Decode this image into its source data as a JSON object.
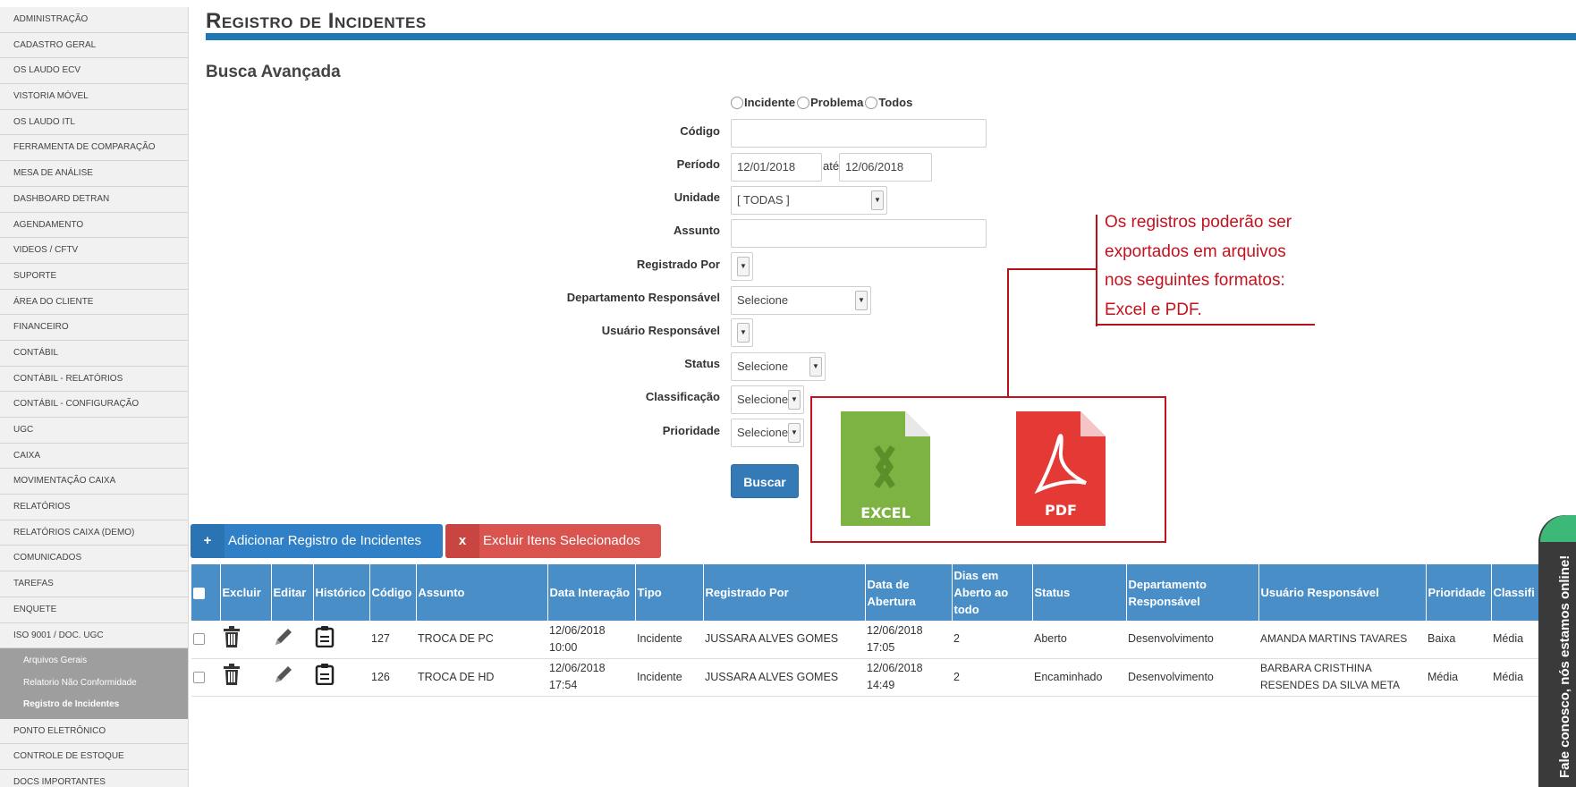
{
  "sidebar": {
    "items": [
      "ADMINISTRAÇÃO",
      "CADASTRO GERAL",
      "OS LAUDO ECV",
      "VISTORIA MÓVEL",
      "OS LAUDO ITL",
      "FERRAMENTA DE COMPARAÇÃO",
      "MESA DE ANÁLISE",
      "DASHBOARD DETRAN",
      "AGENDAMENTO",
      "VIDEOS / CFTV",
      "SUPORTE",
      "ÁREA DO CLIENTE",
      "FINANCEIRO",
      "CONTÁBIL",
      "CONTÁBIL - RELATÓRIOS",
      "CONTÁBIL - CONFIGURAÇÃO",
      "UGC",
      "CAIXA",
      "MOVIMENTAÇÃO CAIXA",
      "RELATÓRIOS",
      "RELATÓRIOS CAIXA (DEMO)",
      "COMUNICADOS",
      "TAREFAS",
      "ENQUETE",
      "ISO 9001 / DOC. UGC"
    ],
    "subitems": [
      "Arquivos Gerais",
      "Relatorio Não Conformidade",
      "Registro de Incidentes"
    ],
    "items_after": [
      "PONTO ELETRÔNICO",
      "CONTROLE DE ESTOQUE",
      "DOCS IMPORTANTES"
    ]
  },
  "header": {
    "title": "Registro de Incidentes"
  },
  "search": {
    "title": "Busca Avançada",
    "radios": [
      "Incidente",
      "Problema",
      "Todos"
    ],
    "labels": {
      "codigo": "Código",
      "periodo": "Período",
      "unidade": "Unidade",
      "assunto": "Assunto",
      "registrado_por": "Registrado Por",
      "departamento": "Departamento Responsável",
      "usuario": "Usuário Responsável",
      "status": "Status",
      "classificacao": "Classificação",
      "prioridade": "Prioridade"
    },
    "values": {
      "codigo": "",
      "periodo_inicio": "12/01/2018",
      "ate": "até",
      "periodo_fim": "12/06/2018",
      "unidade": "[ TODAS ]",
      "assunto": "",
      "registrado_por": "",
      "departamento": "Selecione",
      "usuario": "",
      "status": "Selecione",
      "classificacao": "Selecione",
      "prioridade": "Selecione"
    },
    "buscar_label": "Buscar"
  },
  "annotation": {
    "lines": [
      "Os registros poderão ser",
      "exportados em arquivos",
      "nos seguintes formatos:",
      "Excel e PDF."
    ],
    "excel_label": "EXCEL",
    "pdf_label": "PDF",
    "colors": {
      "annotation": "#c4121e",
      "excel": "#7cb342",
      "pdf": "#d32f2f"
    }
  },
  "actions": {
    "add_prefix": "+",
    "add_label": "Adicionar Registro de Incidentes",
    "delete_prefix": "x",
    "delete_label": "Excluir Itens Selecionados"
  },
  "table": {
    "headers": {
      "excluir": "Excluir",
      "editar": "Editar",
      "historico": "Histórico",
      "codigo": "Código",
      "assunto": "Assunto",
      "data_interacao": "Data Interação",
      "tipo": "Tipo",
      "registrado_por": "Registrado Por",
      "data_abertura": "Data de Abertura",
      "dias_aberto": "Dias em Aberto ao todo",
      "status": "Status",
      "departamento": "Departamento Responsável",
      "usuario": "Usuário Responsável",
      "prioridade": "Prioridade",
      "classificacao": "Classifi"
    },
    "rows": [
      {
        "codigo": "127",
        "assunto": "TROCA DE PC",
        "data_interacao_date": "12/06/2018",
        "data_interacao_time": "10:00",
        "tipo": "Incidente",
        "registrado_por": "JUSSARA ALVES GOMES",
        "data_abertura_date": "12/06/2018",
        "data_abertura_time": "17:05",
        "dias_aberto": "2",
        "status": "Aberto",
        "departamento": "Desenvolvimento",
        "usuario": "AMANDA MARTINS TAVARES",
        "prioridade": "Baixa",
        "classificacao": "Média"
      },
      {
        "codigo": "126",
        "assunto": "TROCA DE HD",
        "data_interacao_date": "12/06/2018",
        "data_interacao_time": "17:54",
        "tipo": "Incidente",
        "registrado_por": "JUSSARA ALVES GOMES",
        "data_abertura_date": "12/06/2018",
        "data_abertura_time": "14:49",
        "dias_aberto": "2",
        "status": "Encaminhado",
        "departamento": "Desenvolvimento",
        "usuario": "BARBARA CRISTHINA RESENDES DA SILVA META",
        "prioridade": "Média",
        "classificacao": "Média"
      }
    ]
  },
  "chat": {
    "label": "Fale conosco, nós estamos online!"
  },
  "colors": {
    "primary": "#337ab7",
    "danger": "#d9534f",
    "table_header": "#4a8ec8",
    "title_bar": "#1f77b4"
  }
}
